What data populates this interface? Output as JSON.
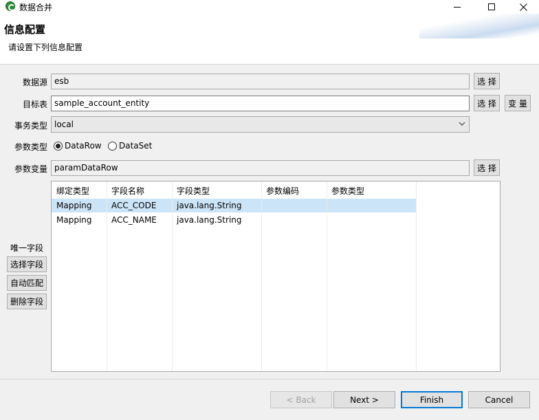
{
  "window": {
    "title": "数据合并"
  },
  "header": {
    "title": "信息配置",
    "description": "请设置下列信息配置"
  },
  "form": {
    "datasource": {
      "label": "数据源",
      "value": "esb",
      "select_label": "选 择"
    },
    "target_table": {
      "label": "目标表",
      "value": "sample_account_entity",
      "select_label": "选 择",
      "variable_label": "变 量"
    },
    "transaction_type": {
      "label": "事务类型",
      "value": "local"
    },
    "param_type": {
      "label": "参数类型",
      "options": [
        "DataRow",
        "DataSet"
      ],
      "selected": "DataRow"
    },
    "param_variable": {
      "label": "参数变量",
      "value": "paramDataRow",
      "select_label": "选 择"
    }
  },
  "table": {
    "columns": [
      "绑定类型",
      "字段名称",
      "字段类型",
      "参数编码",
      "参数类型"
    ],
    "rows": [
      [
        "Mapping",
        "ACC_CODE",
        "java.lang.String",
        "",
        ""
      ],
      [
        "Mapping",
        "ACC_NAME",
        "java.lang.String",
        "",
        ""
      ]
    ],
    "selected_row": 0
  },
  "side": {
    "unique_label": "唯一字段",
    "select_field": "选择字段",
    "auto_match": "自动匹配",
    "delete_field": "删除字段"
  },
  "footer": {
    "back": "< Back",
    "next": "Next >",
    "finish": "Finish",
    "cancel": "Cancel"
  },
  "colors": {
    "selection": "#cce4f7",
    "focus_border": "#0078d7"
  }
}
